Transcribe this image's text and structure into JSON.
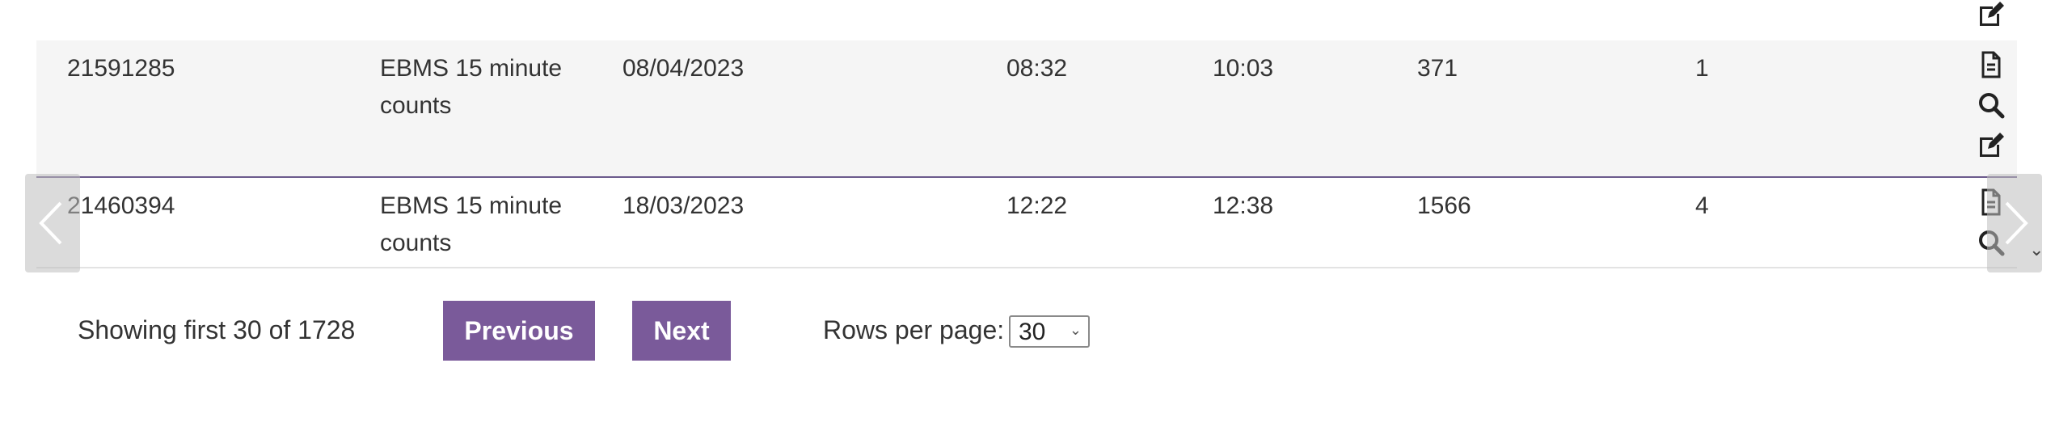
{
  "table": {
    "rows": [
      {
        "id": "21591285",
        "type": "EBMS 15 minute counts",
        "date": "08/04/2023",
        "start": "08:32",
        "end": "10:03",
        "count": "371",
        "n": "1"
      },
      {
        "id": "21460394",
        "type": "EBMS 15 minute counts",
        "date": "18/03/2023",
        "start": "12:22",
        "end": "12:38",
        "count": "1566",
        "n": "4"
      }
    ],
    "action_icons": [
      "document-icon",
      "search-icon",
      "edit-icon"
    ]
  },
  "pager": {
    "status": "Showing first 30 of 1728",
    "previous_label": "Previous",
    "next_label": "Next",
    "rows_per_page_label": "Rows per page:",
    "rows_per_page_value": "30"
  },
  "colors": {
    "accent": "#7a5a9a",
    "row_border": "#6b5a8c",
    "alt_row_bg": "#f5f5f5"
  }
}
